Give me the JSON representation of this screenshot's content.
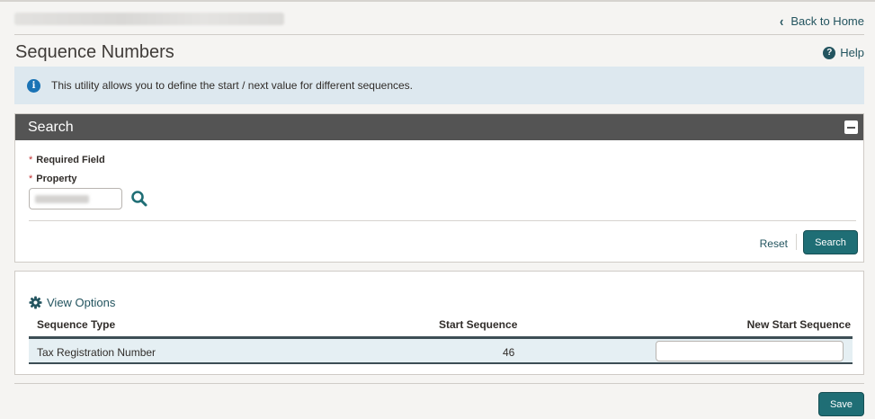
{
  "header": {
    "back_label": "Back to Home",
    "title": "Sequence Numbers",
    "help_label": "Help"
  },
  "info": {
    "message": "This utility allows you to define the start / next value for different sequences."
  },
  "search": {
    "title": "Search",
    "required_label": "Required Field",
    "property_label": "Property",
    "reset_label": "Reset",
    "search_label": "Search"
  },
  "results": {
    "view_options_label": "View Options",
    "columns": [
      "Sequence Type",
      "Start Sequence",
      "New Start Sequence"
    ],
    "rows": [
      {
        "sequence_type": "Tax Registration Number",
        "start_sequence": "46",
        "new_start_sequence": ""
      }
    ]
  },
  "footer": {
    "save_label": "Save"
  },
  "colors": {
    "accent": "#1f6e75",
    "link": "#23545f",
    "header_bar": "#545454",
    "info_bg": "#dde8ef",
    "required_star": "#c13232"
  }
}
